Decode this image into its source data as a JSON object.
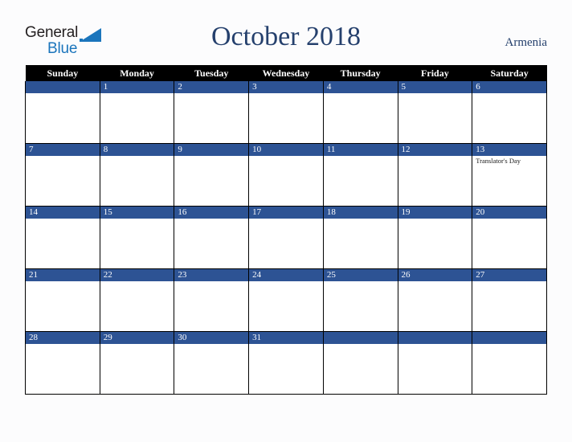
{
  "brand": {
    "name_part1": "General",
    "name_part2": "Blue",
    "triangle_icon": "triangle-icon",
    "color_dark": "#231f20",
    "color_blue": "#1b75bc"
  },
  "header": {
    "title": "October 2018",
    "locale": "Armenia",
    "title_color": "#25406d"
  },
  "calendar": {
    "accent_color": "#2d5394",
    "header_bg": "#000000",
    "weekdays": [
      "Sunday",
      "Monday",
      "Tuesday",
      "Wednesday",
      "Thursday",
      "Friday",
      "Saturday"
    ],
    "weeks": [
      [
        {
          "day": "",
          "events": []
        },
        {
          "day": "1",
          "events": []
        },
        {
          "day": "2",
          "events": []
        },
        {
          "day": "3",
          "events": []
        },
        {
          "day": "4",
          "events": []
        },
        {
          "day": "5",
          "events": []
        },
        {
          "day": "6",
          "events": []
        }
      ],
      [
        {
          "day": "7",
          "events": []
        },
        {
          "day": "8",
          "events": []
        },
        {
          "day": "9",
          "events": []
        },
        {
          "day": "10",
          "events": []
        },
        {
          "day": "11",
          "events": []
        },
        {
          "day": "12",
          "events": []
        },
        {
          "day": "13",
          "events": [
            "Translator's Day"
          ]
        }
      ],
      [
        {
          "day": "14",
          "events": []
        },
        {
          "day": "15",
          "events": []
        },
        {
          "day": "16",
          "events": []
        },
        {
          "day": "17",
          "events": []
        },
        {
          "day": "18",
          "events": []
        },
        {
          "day": "19",
          "events": []
        },
        {
          "day": "20",
          "events": []
        }
      ],
      [
        {
          "day": "21",
          "events": []
        },
        {
          "day": "22",
          "events": []
        },
        {
          "day": "23",
          "events": []
        },
        {
          "day": "24",
          "events": []
        },
        {
          "day": "25",
          "events": []
        },
        {
          "day": "26",
          "events": []
        },
        {
          "day": "27",
          "events": []
        }
      ],
      [
        {
          "day": "28",
          "events": []
        },
        {
          "day": "29",
          "events": []
        },
        {
          "day": "30",
          "events": []
        },
        {
          "day": "31",
          "events": []
        },
        {
          "day": "",
          "events": []
        },
        {
          "day": "",
          "events": []
        },
        {
          "day": "",
          "events": []
        }
      ]
    ]
  }
}
